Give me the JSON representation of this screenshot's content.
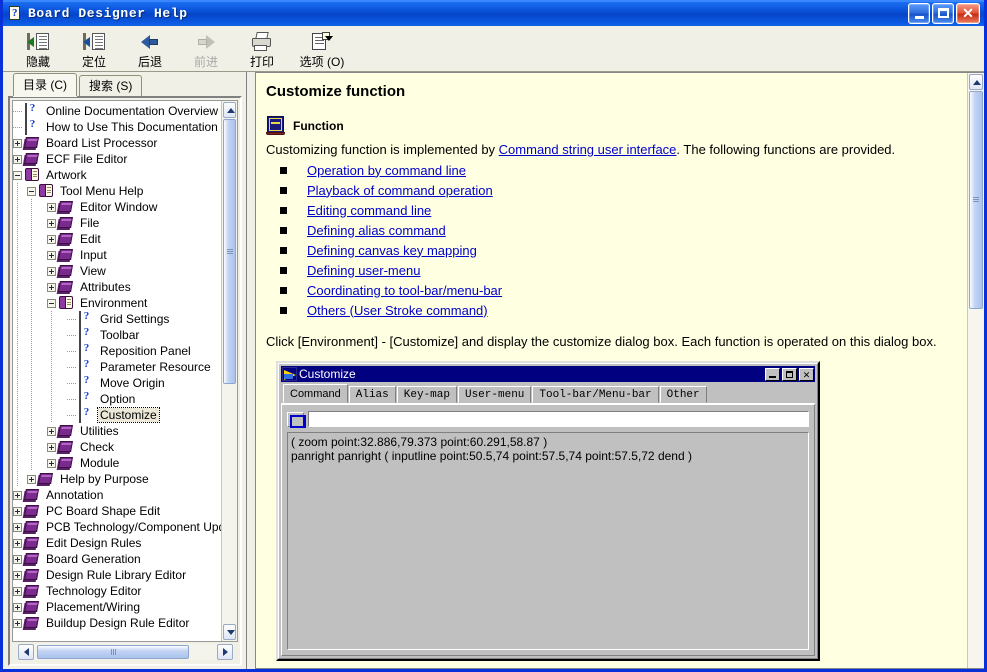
{
  "window": {
    "title": "Board Designer Help",
    "icon": "help-document-icon",
    "buttons": {
      "minimize": "minimize-button",
      "maximize": "maximize-button",
      "close": "close-button"
    }
  },
  "toolbar": {
    "items": [
      {
        "label": "隐藏",
        "icon": "hide-pane-icon",
        "disabled": false
      },
      {
        "label": "定位",
        "icon": "locate-icon",
        "disabled": false
      },
      {
        "label": "后退",
        "icon": "back-arrow-icon",
        "disabled": false
      },
      {
        "label": "前进",
        "icon": "forward-arrow-icon",
        "disabled": true
      },
      {
        "label": "打印",
        "icon": "print-icon",
        "disabled": false
      },
      {
        "label": "选项 (O)",
        "icon": "options-icon",
        "disabled": false
      }
    ]
  },
  "nav": {
    "tabs": [
      {
        "label": "目录 (C)",
        "active": true
      },
      {
        "label": "搜索 (S)",
        "active": false
      }
    ],
    "tree": [
      {
        "label": "Online Documentation Overview",
        "icon": "question-page-icon",
        "depth": 0,
        "toggle": "none"
      },
      {
        "label": "How to Use This Documentation",
        "icon": "question-page-icon",
        "depth": 0,
        "toggle": "none"
      },
      {
        "label": "Board List Processor",
        "icon": "closed-book-icon",
        "depth": 0,
        "toggle": "plus"
      },
      {
        "label": "ECF File Editor",
        "icon": "closed-book-icon",
        "depth": 0,
        "toggle": "plus"
      },
      {
        "label": "Artwork",
        "icon": "open-book-icon",
        "depth": 0,
        "toggle": "minus"
      },
      {
        "label": "Tool Menu Help",
        "icon": "open-book-icon",
        "depth": 1,
        "toggle": "minus"
      },
      {
        "label": "Editor Window",
        "icon": "closed-book-icon",
        "depth": 2,
        "toggle": "plus"
      },
      {
        "label": "File",
        "icon": "closed-book-icon",
        "depth": 2,
        "toggle": "plus"
      },
      {
        "label": "Edit",
        "icon": "closed-book-icon",
        "depth": 2,
        "toggle": "plus"
      },
      {
        "label": "Input",
        "icon": "closed-book-icon",
        "depth": 2,
        "toggle": "plus"
      },
      {
        "label": "View",
        "icon": "closed-book-icon",
        "depth": 2,
        "toggle": "plus"
      },
      {
        "label": "Attributes",
        "icon": "closed-book-icon",
        "depth": 2,
        "toggle": "plus"
      },
      {
        "label": "Environment",
        "icon": "open-book-icon",
        "depth": 2,
        "toggle": "minus"
      },
      {
        "label": "Grid Settings",
        "icon": "question-page-icon",
        "depth": 3,
        "toggle": "none"
      },
      {
        "label": "Toolbar",
        "icon": "question-page-icon",
        "depth": 3,
        "toggle": "none"
      },
      {
        "label": "Reposition Panel",
        "icon": "question-page-icon",
        "depth": 3,
        "toggle": "none"
      },
      {
        "label": "Parameter Resource",
        "icon": "question-page-icon",
        "depth": 3,
        "toggle": "none"
      },
      {
        "label": "Move Origin",
        "icon": "question-page-icon",
        "depth": 3,
        "toggle": "none"
      },
      {
        "label": "Option",
        "icon": "question-page-icon",
        "depth": 3,
        "toggle": "none"
      },
      {
        "label": "Customize",
        "icon": "question-page-icon",
        "depth": 3,
        "toggle": "none",
        "selected": true
      },
      {
        "label": "Utilities",
        "icon": "closed-book-icon",
        "depth": 2,
        "toggle": "plus"
      },
      {
        "label": "Check",
        "icon": "closed-book-icon",
        "depth": 2,
        "toggle": "plus"
      },
      {
        "label": "Module",
        "icon": "closed-book-icon",
        "depth": 2,
        "toggle": "plus"
      },
      {
        "label": "Help by Purpose",
        "icon": "closed-book-icon",
        "depth": 1,
        "toggle": "plus"
      },
      {
        "label": "Annotation",
        "icon": "closed-book-icon",
        "depth": 0,
        "toggle": "plus"
      },
      {
        "label": "PC Board Shape Edit",
        "icon": "closed-book-icon",
        "depth": 0,
        "toggle": "plus"
      },
      {
        "label": "PCB Technology/Component Upd",
        "icon": "closed-book-icon",
        "depth": 0,
        "toggle": "plus"
      },
      {
        "label": "Edit Design Rules",
        "icon": "closed-book-icon",
        "depth": 0,
        "toggle": "plus"
      },
      {
        "label": "Board Generation",
        "icon": "closed-book-icon",
        "depth": 0,
        "toggle": "plus"
      },
      {
        "label": "Design Rule Library Editor",
        "icon": "closed-book-icon",
        "depth": 0,
        "toggle": "plus"
      },
      {
        "label": "Technology Editor",
        "icon": "closed-book-icon",
        "depth": 0,
        "toggle": "plus"
      },
      {
        "label": "Placement/Wiring",
        "icon": "closed-book-icon",
        "depth": 0,
        "toggle": "plus"
      },
      {
        "label": "Buildup Design Rule Editor",
        "icon": "closed-book-icon",
        "depth": 0,
        "toggle": "plus"
      }
    ]
  },
  "content": {
    "title": "Customize function",
    "function_heading": "Function",
    "intro_before": "Customizing function is implemented by ",
    "intro_link": "Command string user interface",
    "intro_after": ". The following functions are provided.",
    "links": [
      "Operation by command line",
      "Playback of command operation",
      "Editing command line",
      "Defining alias command",
      "Defining canvas key mapping",
      "Defining user-menu",
      "Coordinating to tool-bar/menu-bar",
      "Others (User Stroke command)"
    ],
    "closing": "Click [Environment] - [Customize] and display the customize dialog box. Each function is operated on this dialog box."
  },
  "dialog": {
    "title": "Customize",
    "icon": "customize-flag-icon",
    "buttons": {
      "minimize": "_",
      "maximize": "□",
      "close": "×"
    },
    "tabs": [
      {
        "label": "Command",
        "active": true
      },
      {
        "label": "Alias",
        "active": false
      },
      {
        "label": "Key-map",
        "active": false
      },
      {
        "label": "User-menu",
        "active": false
      },
      {
        "label": "Tool-bar/Menu-bar",
        "active": false
      },
      {
        "label": "Other",
        "active": false
      }
    ],
    "command_input": {
      "value": "",
      "placeholder": ""
    },
    "history": [
      "( zoom point:32.886,79.373 point:60.291,58.87 )",
      "panright panright ( inputline point:50.5,74 point:57.5,74 point:57.5,72 dend )"
    ]
  },
  "colors": {
    "title_bar": "#0831d9",
    "toolbar_bg": "#f1f0e6",
    "content_bg": "#ffffe1",
    "link": "#0000cc",
    "dialog_bg": "#c0c0c0",
    "dialog_title": "#000080",
    "tree_book": "#7b2b8f"
  }
}
